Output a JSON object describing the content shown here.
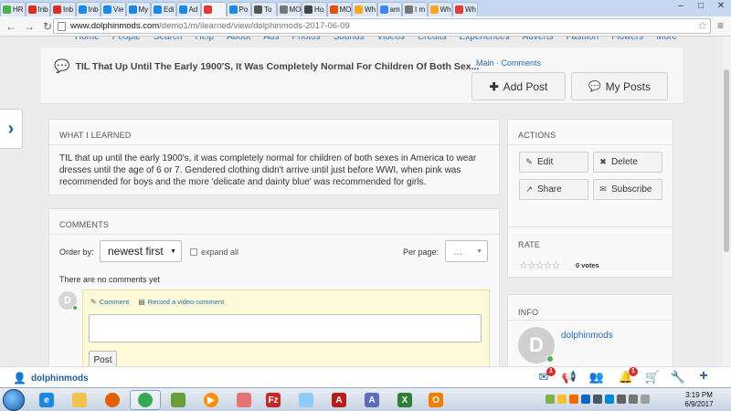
{
  "browser": {
    "tabs": [
      {
        "label": "HR",
        "color": "#4caf50"
      },
      {
        "label": "Inb",
        "color": "#d93025"
      },
      {
        "label": "Inb",
        "color": "#d93025"
      },
      {
        "label": "Inb",
        "color": "#1e88e5"
      },
      {
        "label": "Vie",
        "color": "#1e88e5"
      },
      {
        "label": "My",
        "color": "#1e88e5"
      },
      {
        "label": "Edi",
        "color": "#1e88e5"
      },
      {
        "label": "Ad",
        "color": "#1e88e5"
      },
      {
        "label": "",
        "color": "#e53935"
      },
      {
        "label": "Po",
        "color": "#1e88e5"
      },
      {
        "label": "To",
        "color": "#555555"
      },
      {
        "label": "MO",
        "color": "#777777"
      },
      {
        "label": "Ho",
        "color": "#444444"
      },
      {
        "label": "MO",
        "color": "#e65100"
      },
      {
        "label": "Wh",
        "color": "#f9a825"
      },
      {
        "label": "am",
        "color": "#4285f4"
      },
      {
        "label": "I m",
        "color": "#777777"
      },
      {
        "label": "Wh",
        "color": "#f9a825"
      },
      {
        "label": "Wh",
        "color": "#e53935"
      }
    ],
    "url_host": "www.dolphinmods.com",
    "url_path": "/demo1/m/ilearned/view/dolphinmods-2017-06-09"
  },
  "site_nav": [
    "Home",
    "People",
    "Search",
    "Help",
    "About",
    "Ads",
    "Photos",
    "Sounds",
    "Videos",
    "Credits",
    "Experiences",
    "Adverts",
    "Fashion",
    "Flowers",
    "More"
  ],
  "post": {
    "title": "TIL That Up Until The Early 1900'S, It Was Completely Normal For Children Of Both Sex...",
    "breadcrumb_main": "Main",
    "breadcrumb_sep": "·",
    "breadcrumb_comments": "Comments",
    "add_post_label": "Add Post",
    "my_posts_label": "My Posts"
  },
  "learned": {
    "heading": "WHAT I LEARNED",
    "body": "TIL that up until the early 1900's, it was completely normal for children of both sexes in America to wear dresses until the age of 6 or 7. Gendered clothing didn't arrive until just before WWI, when pink was recommended for boys and the more 'delicate and dainty blue' was recommended for girls."
  },
  "actions": {
    "heading": "ACTIONS",
    "edit": "Edit",
    "delete": "Delete",
    "share": "Share",
    "subscribe": "Subscribe"
  },
  "comments": {
    "heading": "COMMENTS",
    "order_by_label": "Order by:",
    "order_by_value": "newest first",
    "expand_all": "expand all",
    "per_page_label": "Per page:",
    "per_page_value": "...",
    "empty_text": "There are no comments yet",
    "avatar_letter": "D",
    "tab_comment": "Comment",
    "tab_video": "Record a video comment",
    "post_button": "Post"
  },
  "rate": {
    "heading": "RATE",
    "rating": 0,
    "votes_text": "0 votes"
  },
  "info": {
    "heading": "INFO",
    "avatar_letter": "D",
    "username": "dolphinmods"
  },
  "sitebar": {
    "username": "dolphinmods",
    "mail_badge": "1",
    "alerts_badge": "1"
  },
  "taskbar": {
    "time": "3:19 PM",
    "date": "6/9/2017"
  },
  "colors": {
    "link": "#2a6db5",
    "brand": "#1e5e98",
    "online": "#4caf50",
    "badge": "#d32f2f"
  }
}
